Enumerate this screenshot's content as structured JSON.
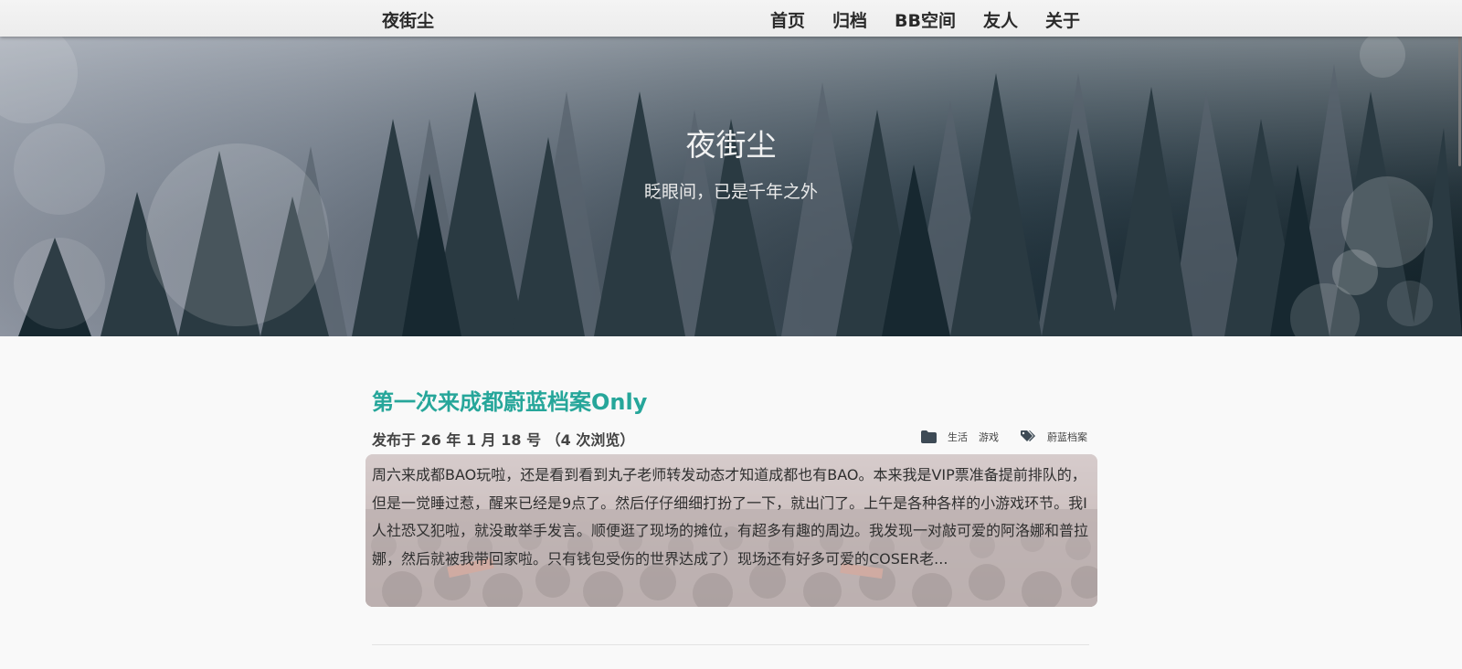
{
  "site": {
    "brand": "夜街尘",
    "nav": [
      "首页",
      "归档",
      "BB空间",
      "友人",
      "关于"
    ]
  },
  "hero": {
    "title": "夜街尘",
    "subtitle": "眨眼间，已是千年之外"
  },
  "post": {
    "title": "第一次来成都蔚蓝档案Only",
    "date": "发布于 26 年 1 月 18 号 （4 次浏览）",
    "categories": [
      "生活",
      "游戏"
    ],
    "tags": [
      "蔚蓝档案"
    ],
    "excerpt": "周六来成都BAO玩啦，还是看到看到丸子老师转发动态才知道成都也有BAO。本来我是VIP票准备提前排队的，但是一觉睡过惹，醒来已经是9点了。然后仔仔细细打扮了一下，就出门了。上午是各种各样的小游戏环节。我I人社恐又犯啦，就没敢举手发言。顺便逛了现场的摊位，有超多有趣的周边。我发现一对敲可爱的阿洛娜和普拉娜，然后就被我带回家啦。只有钱包受伤的世界达成了）现场还有好多可爱的COSER老..."
  },
  "icons": {
    "category": "folder-icon",
    "tag": "tags-icon"
  },
  "colors": {
    "accent": "#26a69a"
  }
}
